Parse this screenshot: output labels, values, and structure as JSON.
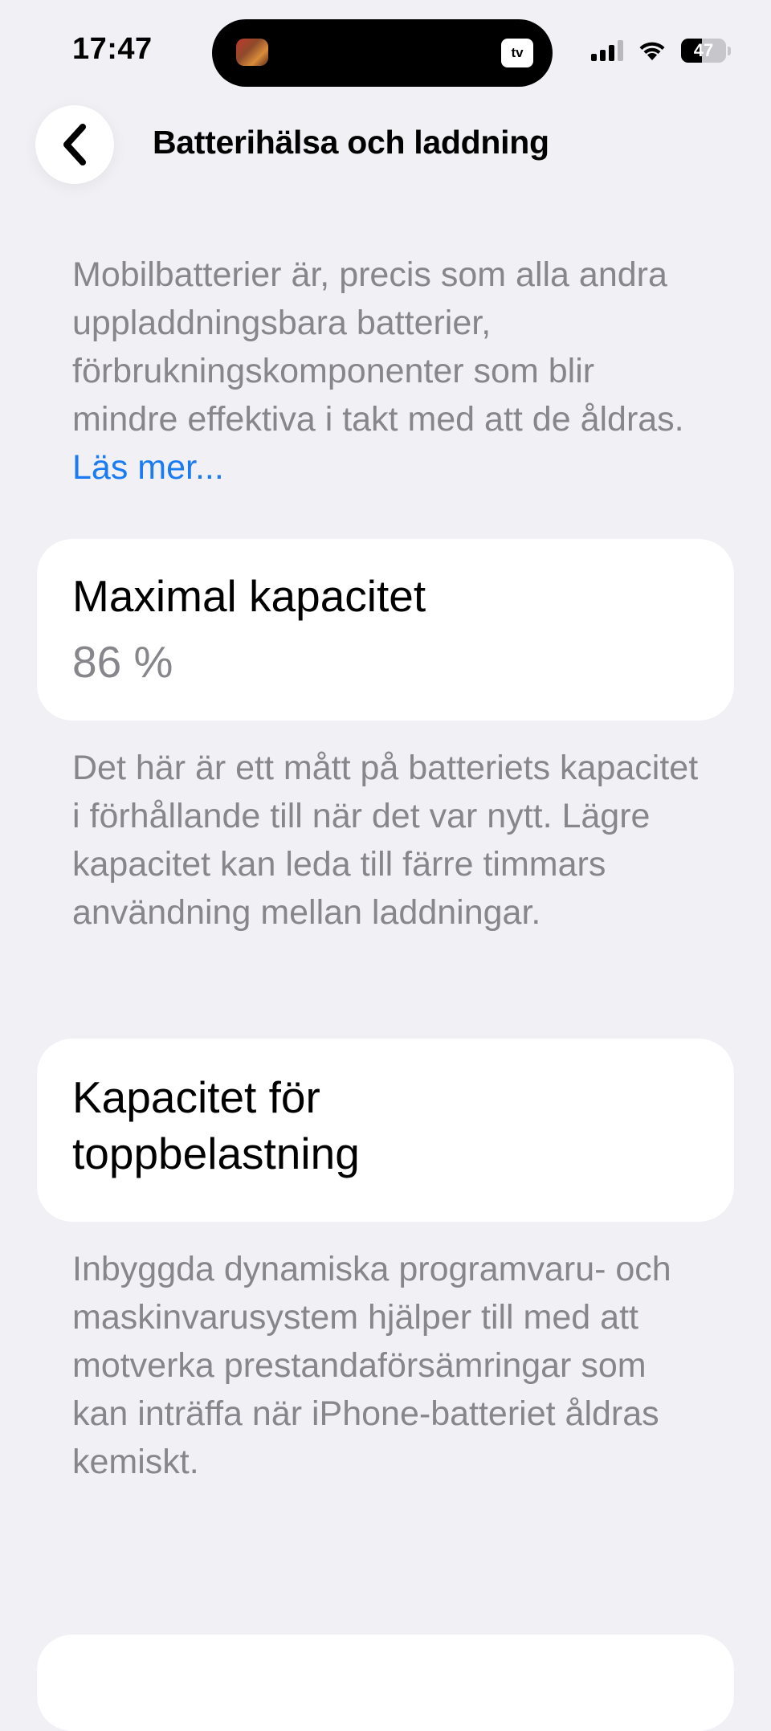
{
  "status_bar": {
    "time": "17:47",
    "battery_level": 47,
    "battery_text": "47",
    "island_badge": "tv",
    "island_badge_icon": "apple-tv-icon"
  },
  "nav": {
    "back_icon": "chevron-left-icon",
    "title": "Batterihälsa och laddning"
  },
  "intro": {
    "text": "Mobilbatterier är, precis som alla andra uppladdningsbara batterier, förbrukningskompo­nenter som blir mindre effektiva i takt med att de åldras.",
    "link": "Läs mer..."
  },
  "max_capacity": {
    "title": "Maximal kapacitet",
    "value": "86 %",
    "description": "Det här är ett mått på batteriets kapacitet i förhållande till när det var nytt. Lägre kapacitet kan leda till färre timmars användning mellan laddningar."
  },
  "peak_performance": {
    "title": "Kapacitet för toppbelastning",
    "description": "Inbyggda dynamiska programvaru- och maskinvarusystem hjälper till med att motverka prestandaförsämringar som kan inträffa när iPhone-batteriet åldras kemiskt."
  },
  "colors": {
    "background": "#f0f0f5",
    "secondary_text": "#86868b",
    "link": "#1a7cf0",
    "card": "#ffffff"
  }
}
